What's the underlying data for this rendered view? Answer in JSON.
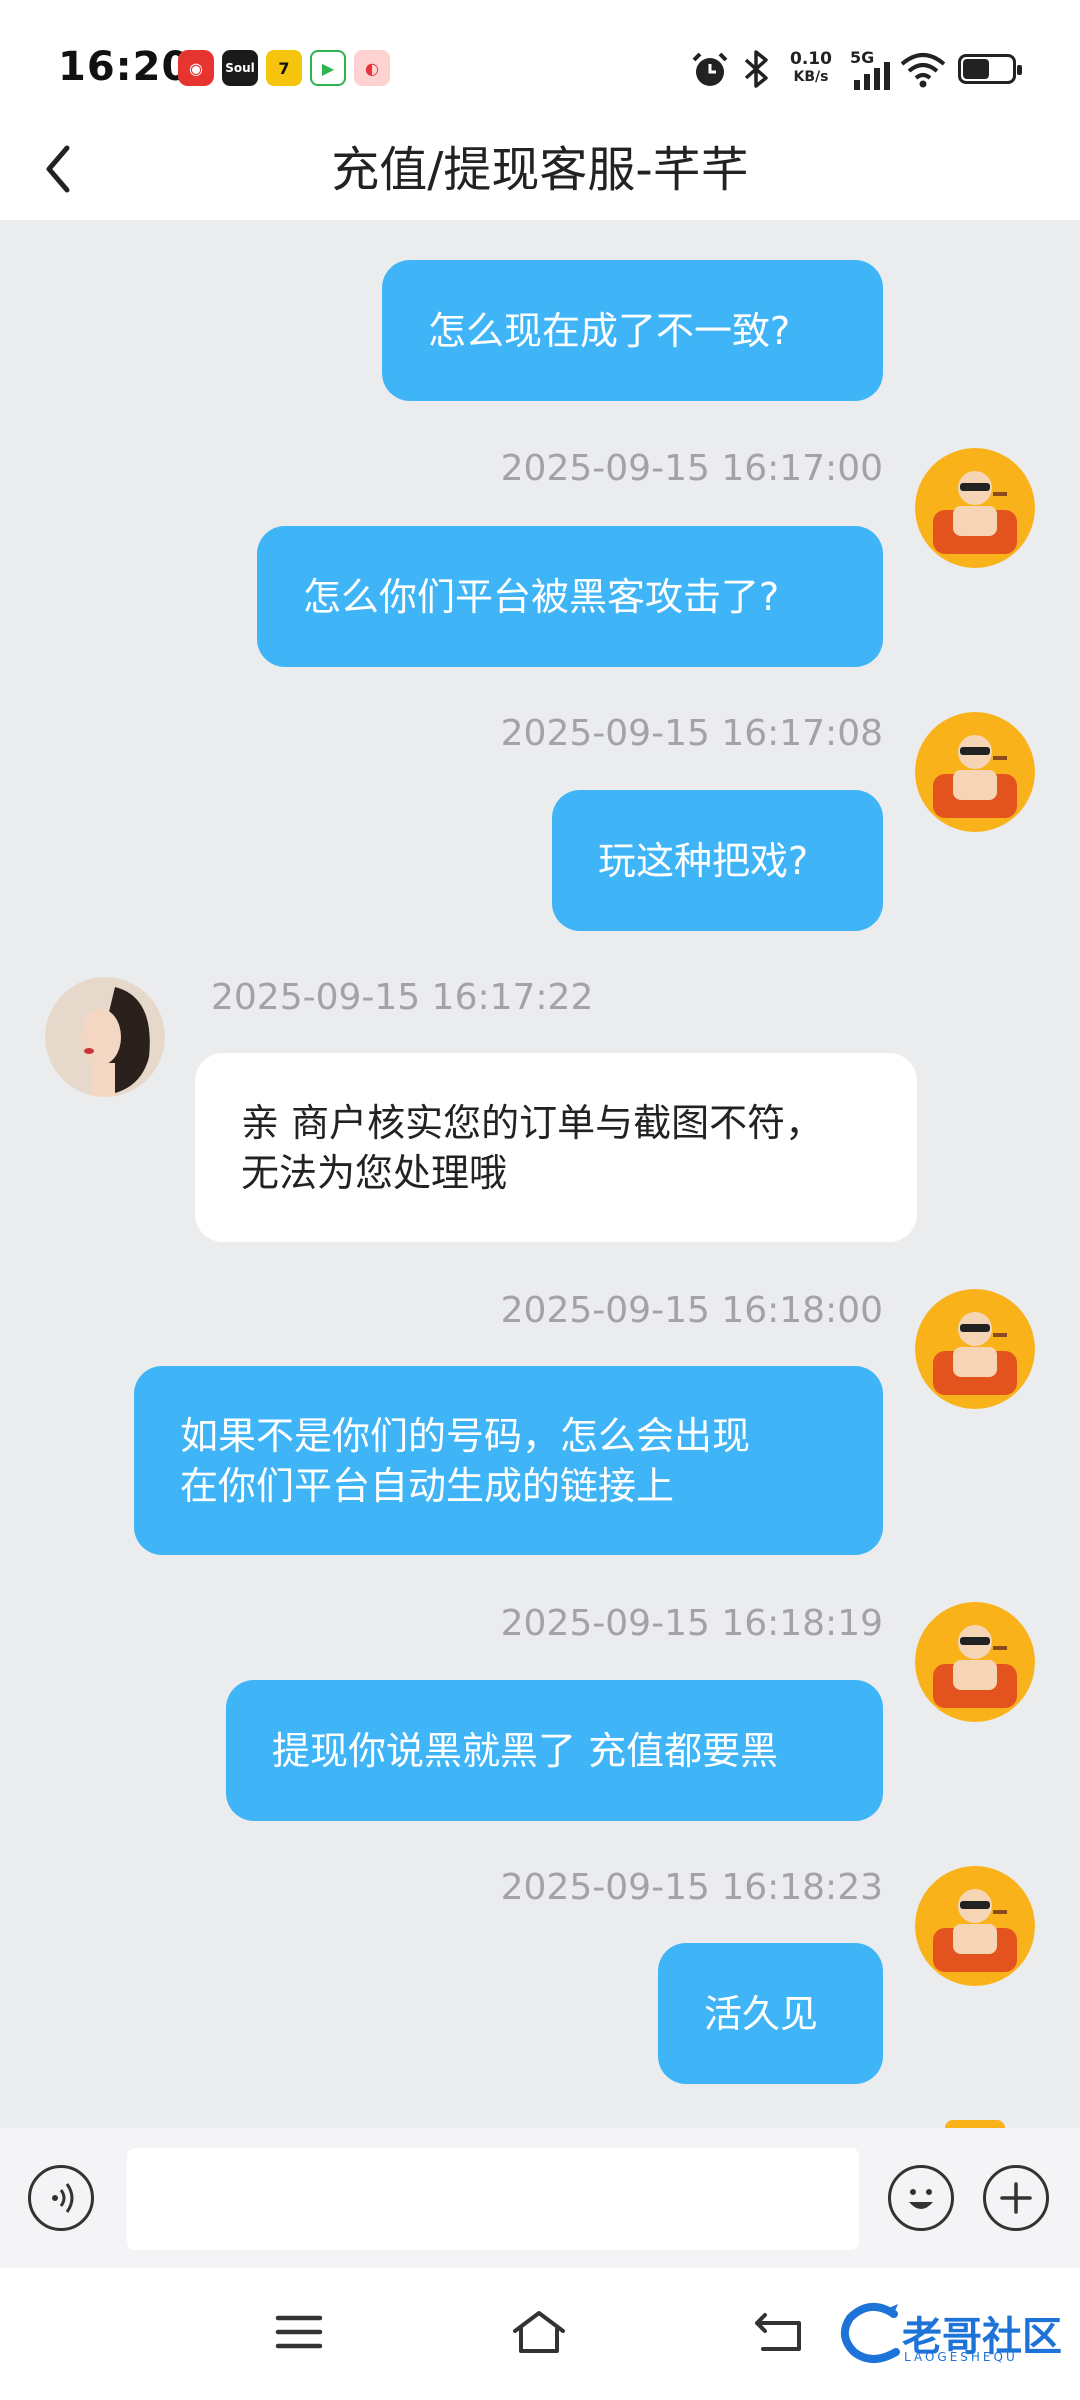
{
  "status_bar": {
    "time": "16:20",
    "notification_icons": [
      "netease-music-icon",
      "soul-icon",
      "qmusic-icon",
      "iqiyi-icon",
      "weibo-icon"
    ],
    "net_speed_value": "0.10",
    "net_speed_unit": "KB/s",
    "network": "5G"
  },
  "header": {
    "title": "充值/提现客服-芊芊"
  },
  "messages": [
    {
      "time": "",
      "text": "怎么现在成了不一致?",
      "from": "me"
    },
    {
      "time": "2025-09-15 16:17:00",
      "text": "怎么你们平台被黑客攻击了?",
      "from": "me"
    },
    {
      "time": "2025-09-15 16:17:08",
      "text": "玩这种把戏?",
      "from": "me"
    },
    {
      "time": "2025-09-15 16:17:22",
      "text_line1": "亲 商户核实您的订单与截图不符，",
      "text_line2": "无法为您处理哦",
      "from": "agent"
    },
    {
      "time": "2025-09-15 16:18:00",
      "text_line1": "如果不是你们的号码，怎么会出现",
      "text_line2": "在你们平台自动生成的链接上",
      "from": "me"
    },
    {
      "time": "2025-09-15 16:18:19",
      "text": "提现你说黑就黑了 充值都要黑",
      "from": "me"
    },
    {
      "time": "2025-09-15 16:18:23",
      "text": "活久见",
      "from": "me"
    }
  ],
  "input": {
    "value": "",
    "placeholder": ""
  },
  "watermark": {
    "text": "老哥社区",
    "sub": "LAOGESHEQU"
  },
  "colors": {
    "bubble_out": "#3fb5f7",
    "bubble_in": "#ffffff",
    "chat_bg": "#ebecee",
    "timestamp": "#a3a3a6",
    "watermark": "#1e73d8"
  }
}
